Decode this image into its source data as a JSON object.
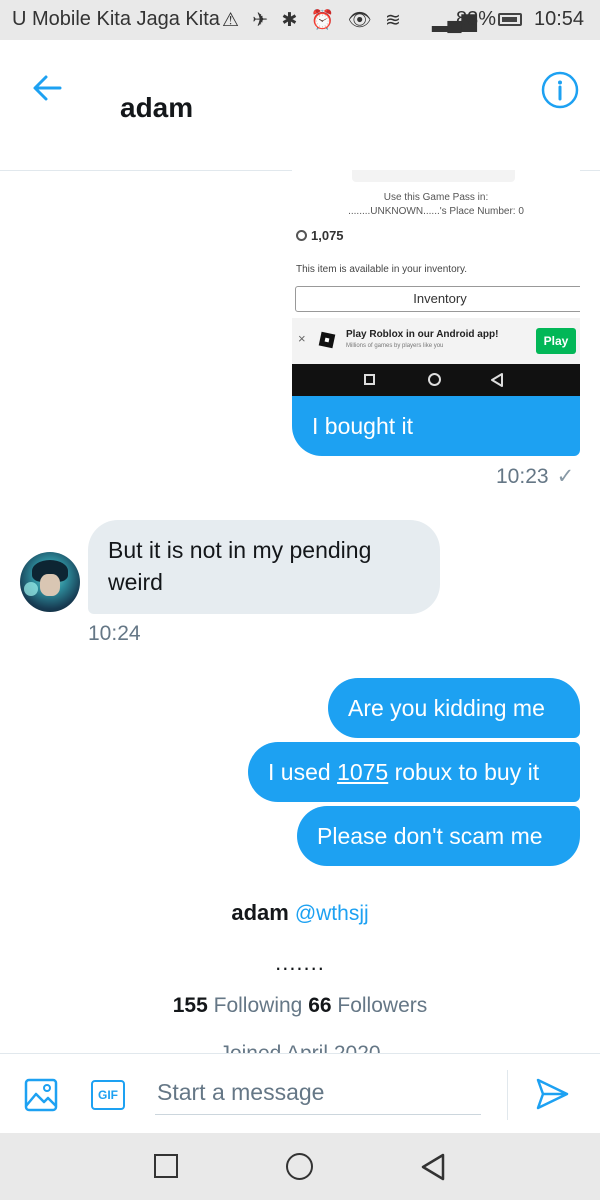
{
  "status_bar": {
    "carrier": "U Mobile Kita Jaga Kita",
    "battery": "83%",
    "time": "10:54"
  },
  "header": {
    "title": "adam"
  },
  "shared_screenshot": {
    "game_pass_line1": "Use this Game Pass in:",
    "game_pass_line2": "........UNKNOWN......'s Place Number: 0",
    "price": "1,075",
    "availability": "This item is available in your inventory.",
    "inventory_button": "Inventory",
    "promo_close": "×",
    "promo_title": "Play Roblox in our Android app!",
    "promo_subtitle": "Millions of games by players like you",
    "promo_play": "Play"
  },
  "messages": {
    "m1": "I bought it",
    "m1_time": "10:23",
    "m1_check": "✓",
    "m2": "But it is not in my pending weird",
    "m2_time": "10:24",
    "m3": "Are you kidding me",
    "m4_part1": "I used ",
    "m4_link": "1075",
    "m4_part2": " robux to buy it",
    "m5": "Please don't scam me"
  },
  "profile": {
    "name": "adam",
    "handle": "@wthsjj",
    "bio": ".......",
    "following_count": "155",
    "following_label": " Following ",
    "followers_count": "66",
    "followers_label": " Followers",
    "joined": "Joined April 2020"
  },
  "composer": {
    "placeholder": "Start a message",
    "gif_label": "GIF"
  },
  "colors": {
    "accent": "#1da1f2",
    "incoming_bubble": "#e6ecf0",
    "secondary_text": "#657786"
  }
}
